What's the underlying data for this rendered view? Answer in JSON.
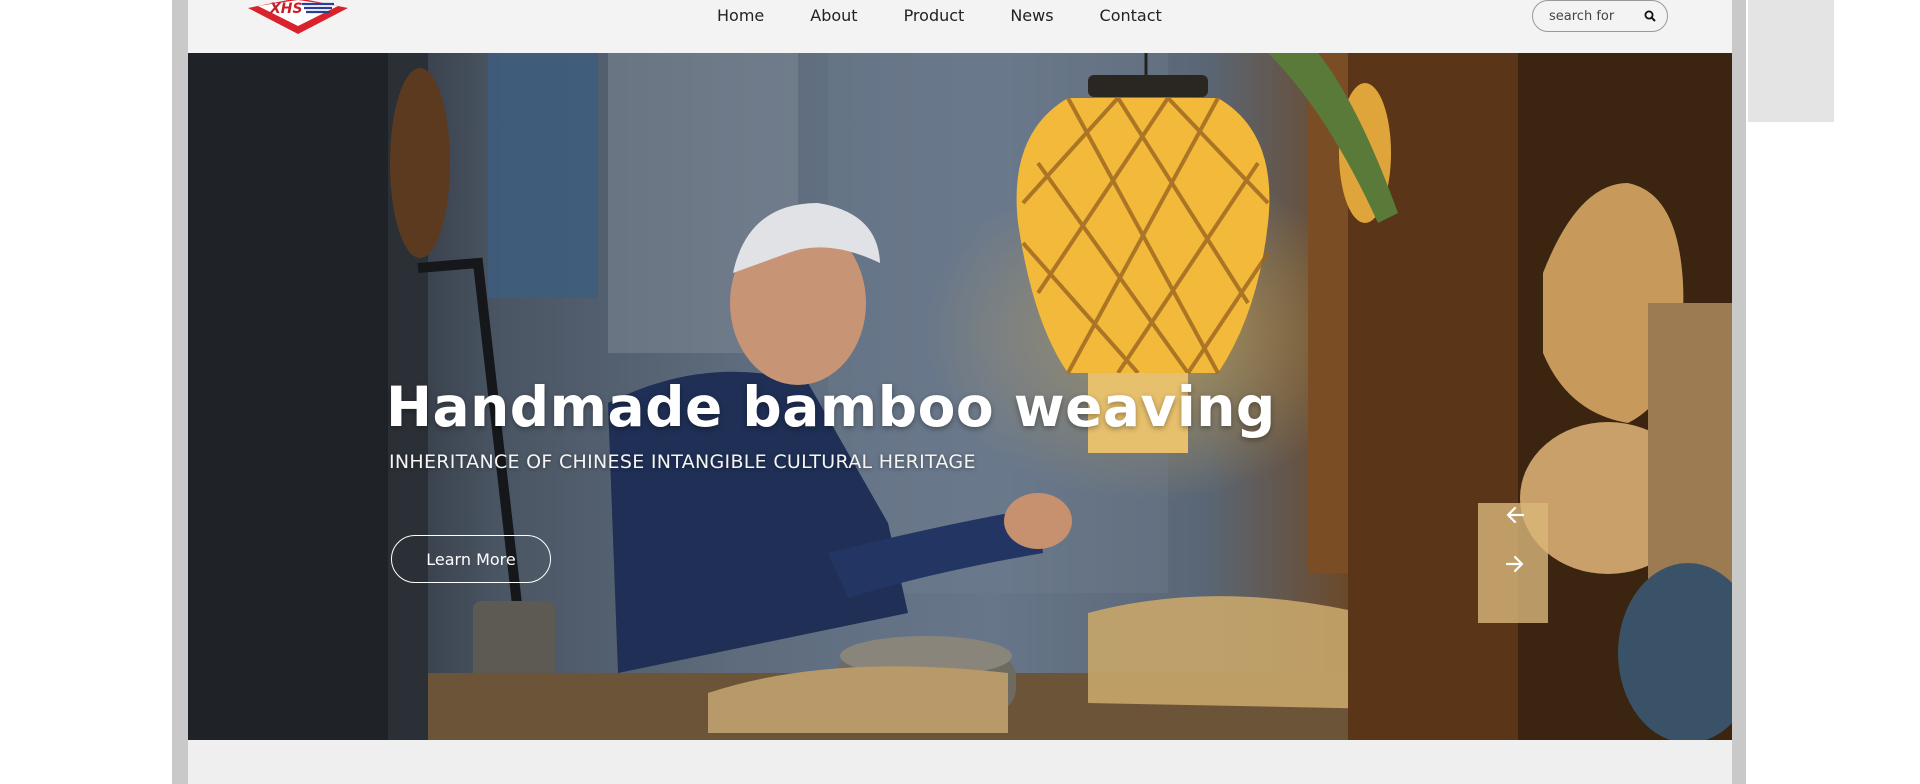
{
  "brand": {
    "logo_text": "XHS",
    "logo_color": "#c8202a"
  },
  "nav": {
    "items": [
      {
        "label": "Home"
      },
      {
        "label": "About"
      },
      {
        "label": "Product"
      },
      {
        "label": "News"
      },
      {
        "label": "Contact"
      }
    ]
  },
  "search": {
    "placeholder": "search for",
    "icon": "search-icon"
  },
  "hero": {
    "title": "Handmade bamboo weaving",
    "subtitle": "INHERITANCE OF CHINESE INTANGIBLE CULTURAL HERITAGE",
    "cta_label": "Learn More",
    "prev_icon": "arrow-left-icon",
    "next_icon": "arrow-right-icon"
  },
  "colors": {
    "frame": "#c9c9c9",
    "header_bg": "#f3f3f3",
    "hero_text": "#ffffff",
    "lantern": "#f2b93b"
  }
}
